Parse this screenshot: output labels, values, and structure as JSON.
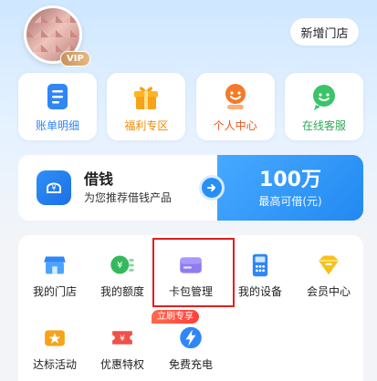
{
  "header": {
    "vip_badge": "VIP",
    "new_store_button": "新增门店"
  },
  "quick_actions": [
    {
      "label": "账单明细",
      "icon": "bill-icon",
      "color": "#2f86f6"
    },
    {
      "label": "福利专区",
      "icon": "gift-icon",
      "color": "#f6a21a"
    },
    {
      "label": "个人中心",
      "icon": "person-icon",
      "color": "#f37a2a"
    },
    {
      "label": "在线客服",
      "icon": "chat-icon",
      "color": "#3cc36a"
    }
  ],
  "loan": {
    "title": "借钱",
    "subtitle": "为您推荐借钱产品",
    "amount": "100万",
    "amount_label": "最高可借(元)"
  },
  "services": [
    {
      "label": "我的门店",
      "icon": "store-icon"
    },
    {
      "label": "我的额度",
      "icon": "credit-limit-icon"
    },
    {
      "label": "卡包管理",
      "icon": "card-wallet-icon"
    },
    {
      "label": "我的设备",
      "icon": "device-icon"
    },
    {
      "label": "会员中心",
      "icon": "member-icon"
    },
    {
      "label": "达标活动",
      "icon": "activity-icon"
    },
    {
      "label": "优惠特权",
      "icon": "discount-icon"
    },
    {
      "label": "免费充电",
      "icon": "charging-icon"
    }
  ],
  "promo_tag": "立刷专享",
  "colors": {
    "accent": "#2289f2",
    "highlight": "#e0201e"
  }
}
